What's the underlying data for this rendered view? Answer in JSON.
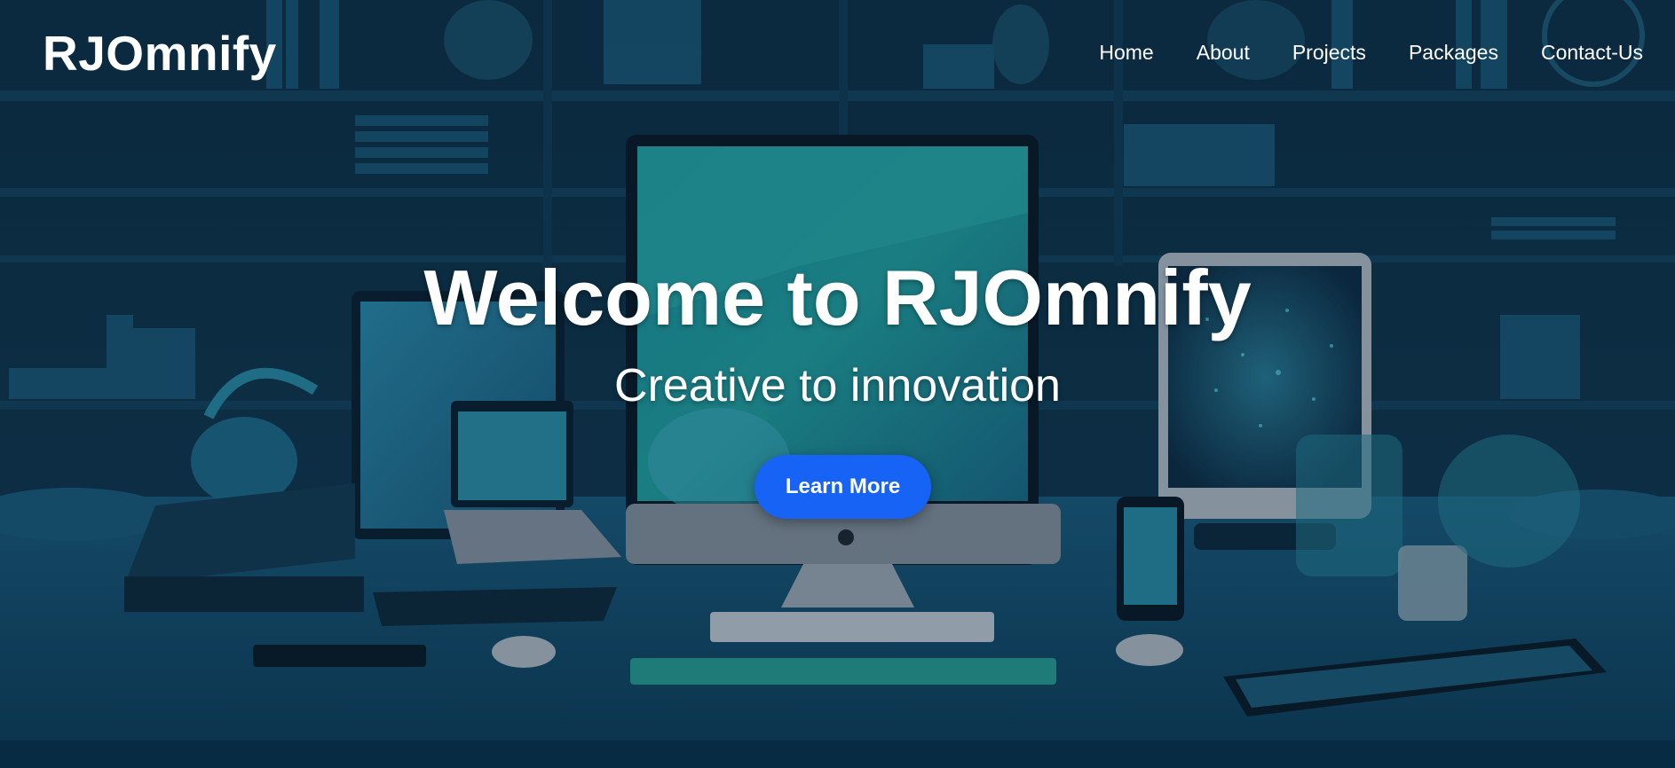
{
  "brand": {
    "logo_text": "RJOmnify"
  },
  "nav": {
    "items": [
      {
        "label": "Home"
      },
      {
        "label": "About"
      },
      {
        "label": "Projects"
      },
      {
        "label": "Packages"
      },
      {
        "label": "Contact-Us"
      }
    ]
  },
  "hero": {
    "title": "Welcome to RJOmnify",
    "subtitle": "Creative to innovation",
    "cta_label": "Learn More",
    "background": "office-desk-with-devices-illustration"
  },
  "colors": {
    "accent": "#1663f5",
    "background": "#0c2a3d",
    "text": "#ffffff"
  }
}
